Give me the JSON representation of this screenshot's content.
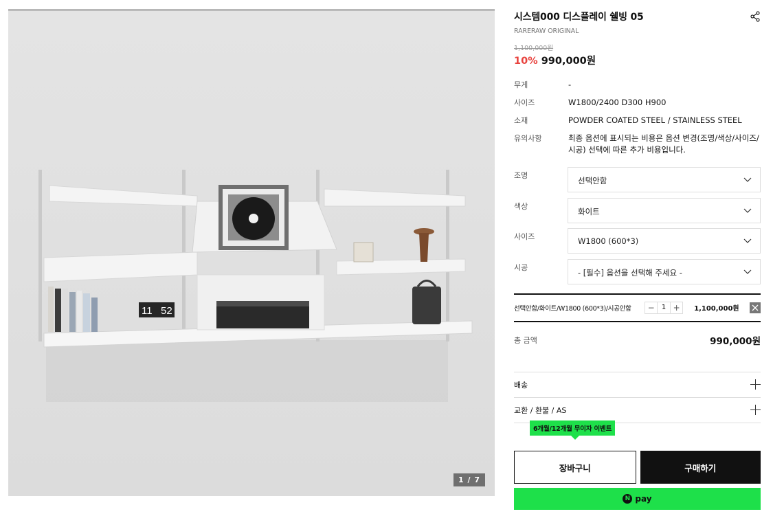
{
  "gallery": {
    "pager": "1 / 7",
    "clock_left": "11",
    "clock_right": "52"
  },
  "product": {
    "title": "시스템000 디스플레이 쉘빙 05",
    "brand": "RARERAW ORIGINAL",
    "original_price": "1,100,000원",
    "discount": "10%",
    "price": "990,000원"
  },
  "specs": [
    {
      "key": "무게",
      "value": "-"
    },
    {
      "key": "사이즈",
      "value": "W1800/2400 D300 H900"
    },
    {
      "key": "소재",
      "value": "POWDER COATED STEEL / STAINLESS STEEL"
    },
    {
      "key": "유의사항",
      "value": "최종 옵션에 표시되는 비용은 옵션 변경(조명/색상/사이즈/시공) 선택에 따른 추가 비용입니다."
    }
  ],
  "options": [
    {
      "key": "조명",
      "value": "선택안함"
    },
    {
      "key": "색상",
      "value": "화이트"
    },
    {
      "key": "사이즈",
      "value": "W1800 (600*3)"
    },
    {
      "key": "시공",
      "value": "- [필수] 옵션을 선택해 주세요 -"
    }
  ],
  "selected": {
    "label": "선택안함/화이트/W1800 (600*3)/시공안함",
    "qty": "1",
    "minus": "−",
    "plus": "+",
    "subtotal": "1,100,000원"
  },
  "total": {
    "label": "총 금액",
    "amount": "990,000원"
  },
  "accordion": [
    {
      "label": "배송"
    },
    {
      "label": "교환 / 환불 / AS"
    }
  ],
  "event_badge": "6개월/12개월 무이자 이벤트",
  "buttons": {
    "cart": "장바구니",
    "buy": "구매하기",
    "npay_mark": "N",
    "npay": "pay"
  },
  "colors": {
    "discount": "#e8423d",
    "npay_green": "#1ee04a",
    "buy_bg": "#111111"
  }
}
